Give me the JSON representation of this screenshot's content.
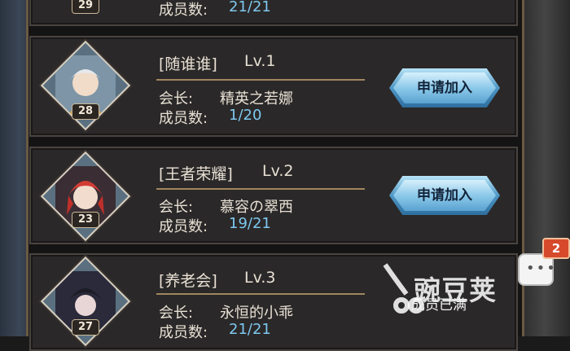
{
  "guilds": [
    {
      "members": "21/21"
    },
    {
      "name": "[随谁谁]",
      "level": "Lv.1",
      "leader_label": "会长:",
      "leader": "精英之若娜",
      "members_label": "成员数:",
      "members": "1/20",
      "badge": "28",
      "button": "申请加入"
    },
    {
      "name": "[王者荣耀]",
      "level": "Lv.2",
      "leader_label": "会长:",
      "leader": "慕容の翠西",
      "members_label": "成员数:",
      "members": "19/21",
      "badge": "23",
      "button": "申请加入"
    },
    {
      "name": "[养老会]",
      "level": "Lv.3",
      "leader_label": "会长:",
      "leader": "永恒的小乖",
      "members_label": "成员数:",
      "members": "21/21",
      "badge": "27",
      "status": "成员已满"
    }
  ],
  "top": {
    "badge": "29",
    "members_label": "成员数:"
  },
  "chat": {
    "notifications": "2"
  },
  "watermark": "豌豆荚",
  "colors": {
    "member_count": "#7ec8f0",
    "button": "#5aa2d0",
    "notification": "#d64a2b"
  }
}
